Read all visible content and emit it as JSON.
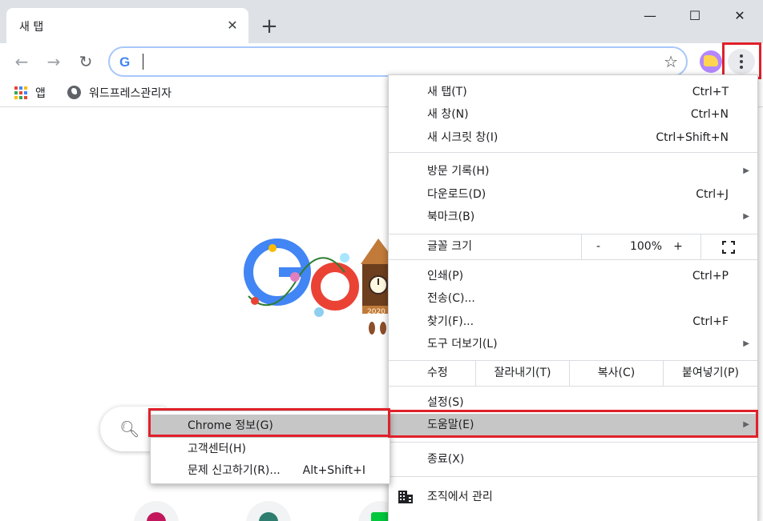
{
  "tab": {
    "title": "새 탭",
    "close": "✕",
    "new": "+"
  },
  "window": {
    "minimize": "—",
    "maximize": "☐",
    "close": "✕"
  },
  "toolbar": {
    "back": "←",
    "forward": "→",
    "reload": "↻",
    "omnibox_value": "",
    "star": "☆"
  },
  "bookmarks": [
    {
      "label": "앱",
      "icon": "apps-grid-icon"
    },
    {
      "label": "워드프레스관리자",
      "icon": "globe-icon"
    }
  ],
  "menu": {
    "items": [
      {
        "label": "새 탭(T)",
        "shortcut": "Ctrl+T"
      },
      {
        "label": "새 창(N)",
        "shortcut": "Ctrl+N"
      },
      {
        "label": "새 시크릿 창(I)",
        "shortcut": "Ctrl+Shift+N"
      },
      {
        "label": "방문 기록(H)",
        "shortcut": ""
      },
      {
        "label": "다운로드(D)",
        "shortcut": "Ctrl+J"
      },
      {
        "label": "북마크(B)",
        "shortcut": ""
      },
      {
        "label": "인쇄(P)",
        "shortcut": "Ctrl+P"
      },
      {
        "label": "전송(C)...",
        "shortcut": ""
      },
      {
        "label": "찾기(F)...",
        "shortcut": "Ctrl+F"
      },
      {
        "label": "도구 더보기(L)",
        "shortcut": ""
      },
      {
        "label": "설정(S)",
        "shortcut": ""
      },
      {
        "label": "도움말(E)",
        "shortcut": ""
      },
      {
        "label": "종료(X)",
        "shortcut": ""
      },
      {
        "label": "조직에서 관리",
        "shortcut": ""
      }
    ],
    "zoom": {
      "label": "글꼴 크기",
      "minus": "-",
      "value": "100%",
      "plus": "+"
    },
    "edit": {
      "label": "수정",
      "cut": "잘라내기(T)",
      "copy": "복사(C)",
      "paste": "붙여넣기(P)"
    }
  },
  "help_submenu": [
    {
      "label": "Chrome 정보(G)",
      "shortcut": ""
    },
    {
      "label": "고객센터(H)",
      "shortcut": ""
    },
    {
      "label": "문제 신고하기(R)...",
      "shortcut": "Alt+Shift+I"
    }
  ],
  "doodle": {
    "badge": "2020"
  },
  "colors": {
    "highlight": "#e0202a",
    "hover": "#c6c6c6",
    "tabstrip": "#dee1e6"
  }
}
